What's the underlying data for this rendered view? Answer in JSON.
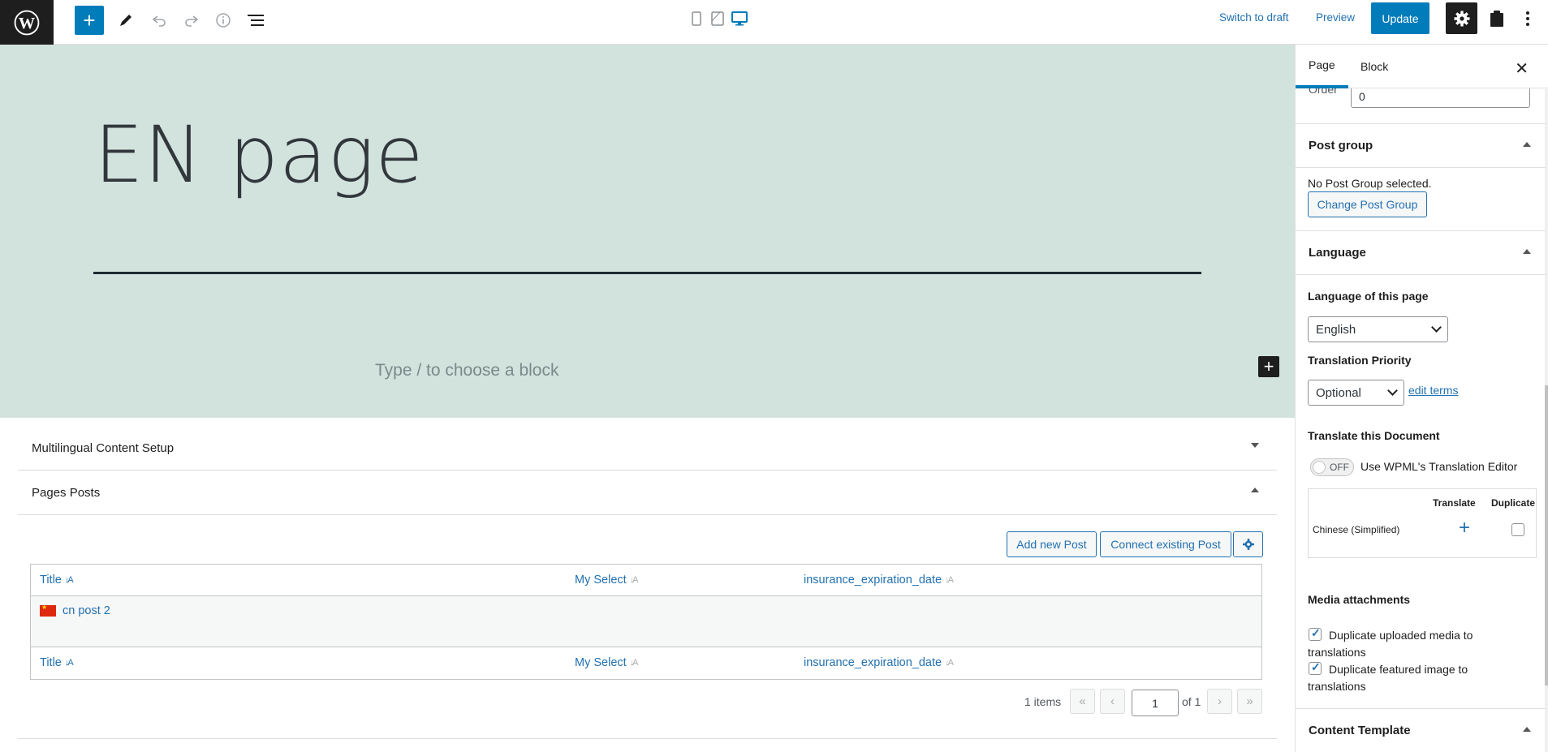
{
  "toolbar": {
    "icons": {
      "logo": "wordpress-logo",
      "add": "plus-icon",
      "tools": "pencil-icon",
      "undo": "undo-icon",
      "redo": "redo-icon",
      "details": "info-icon",
      "list_view": "list-view-icon",
      "mobile": "mobile-icon",
      "tablet": "tablet-icon",
      "desktop": "desktop-icon",
      "settings": "gear-icon",
      "plugin": "clipboard-icon",
      "more": "kebab-menu-icon"
    },
    "add_symbol": "+",
    "switch_to_draft": "Switch to draft",
    "preview": "Preview",
    "update": "Update"
  },
  "canvas": {
    "title": "EN page",
    "block_placeholder": "Type / to choose a block",
    "inline_add_symbol": "+",
    "cover_color": "#d2e3de"
  },
  "metaboxes": {
    "multilingual": {
      "title": "Multilingual Content Setup"
    },
    "pages_posts": {
      "title": "Pages Posts",
      "add_new": "Add new Post",
      "connect_existing": "Connect existing Post",
      "columns": [
        "Title",
        "My Select",
        "insurance_expiration_date"
      ],
      "rows": [
        {
          "flag": "cn-flag",
          "title": "cn post 2"
        }
      ],
      "item_count": "1 items",
      "pager": {
        "first": "«",
        "prev": "‹",
        "current": "1",
        "of_total": "of 1",
        "next": "›",
        "last": "»"
      }
    }
  },
  "sidebar": {
    "tabs": [
      "Page",
      "Block"
    ],
    "close_symbol": "✕",
    "order": {
      "label": "Order",
      "value": "0"
    },
    "post_group": {
      "title": "Post group",
      "status": "No Post Group selected.",
      "button": "Change Post Group"
    },
    "language": {
      "title": "Language",
      "language_label": "Language of this page",
      "language_value": "English",
      "priority_label": "Translation Priority",
      "priority_value": "Optional",
      "edit_terms": "edit terms",
      "translate_doc_label": "Translate this Document",
      "toggle_state": "OFF",
      "toggle_label": "Use WPML's Translation Editor",
      "table_headers": [
        "Translate",
        "Duplicate"
      ],
      "table_rows": [
        {
          "language": "Chinese (Simplified)",
          "translate_symbol": "+"
        }
      ],
      "media_label": "Media attachments",
      "media_options": [
        {
          "label": "Duplicate uploaded media to translations",
          "checked": true
        },
        {
          "label": "Duplicate featured image to translations",
          "checked": true
        }
      ]
    },
    "content_template": {
      "title": "Content Template"
    }
  },
  "colors": {
    "accent": "#007cba",
    "link": "#2271b1",
    "dark": "#1e1e1e"
  }
}
